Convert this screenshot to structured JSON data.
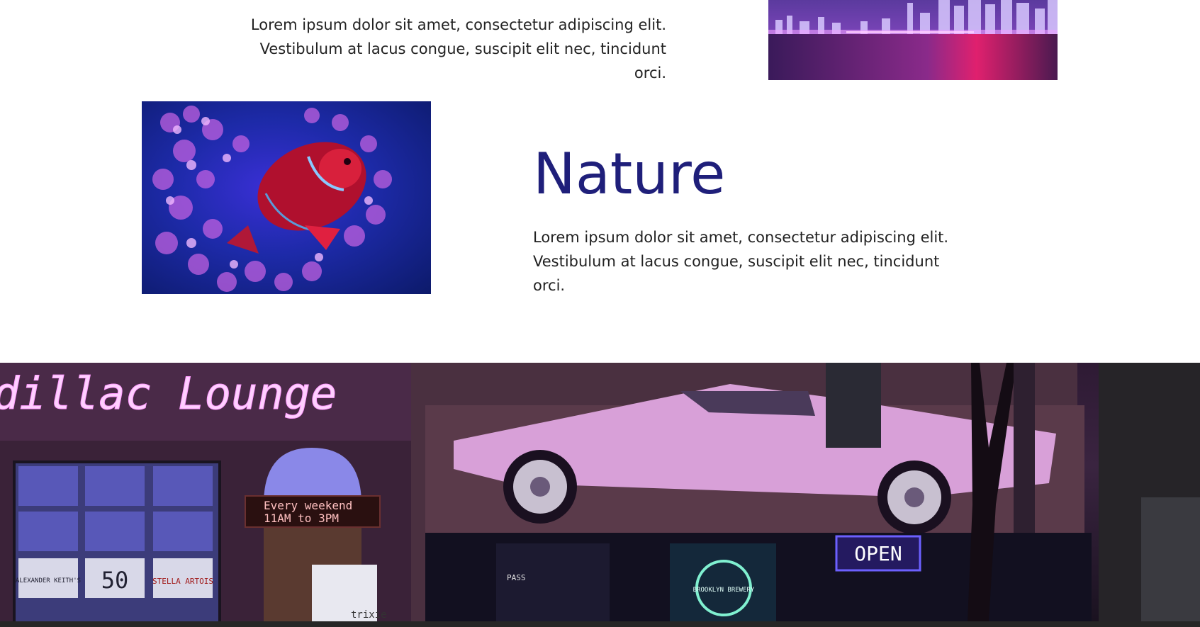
{
  "section_top": {
    "text_line1": "Lorem ipsum dolor sit amet, consectetur adipiscing elit.",
    "text_line2": "Vestibulum at lacus congue, suscipit elit nec, tincidunt orci."
  },
  "section_nature": {
    "heading": "Nature",
    "text_line1": "Lorem ipsum dolor sit amet, consectetur adipiscing elit.",
    "text_line2": "Vestibulum at lacus congue, suscipit elit nec, tincidunt orci."
  },
  "banner": {
    "neon_sign": "dillac Lounge",
    "led_line1": "Every weekend",
    "led_line2": "11AM to 3PM",
    "open_sign": "OPEN",
    "brewery_sign": "BROOKLYN BREWERY",
    "window_signs": [
      "ALEXANDER KEITH'S",
      "50",
      "STELLA ARTOIS"
    ],
    "pass_sign": "PASS",
    "trixie_sign": "trixie"
  },
  "colors": {
    "heading": "#1f1f7a",
    "body_text": "#222222",
    "background": "#ffffff",
    "bottom_bar": "#262626"
  }
}
